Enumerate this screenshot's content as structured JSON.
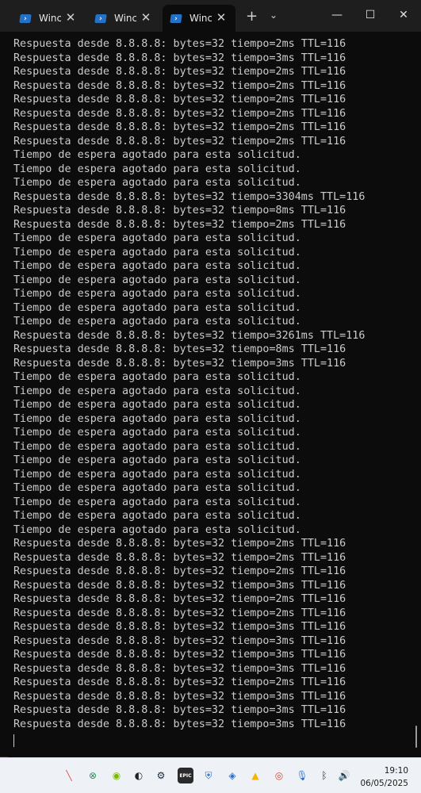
{
  "tabs": [
    {
      "title": "Winc",
      "active": false
    },
    {
      "title": "Winc",
      "active": false
    },
    {
      "title": "Winc",
      "active": true
    }
  ],
  "tabbar": {
    "new_tab": "+",
    "dropdown": "⌄"
  },
  "window_controls": {
    "minimize": "—",
    "maximize": "☐",
    "close": "✕"
  },
  "desktop_glyph": "nt",
  "terminal": {
    "lines": [
      "Respuesta desde 8.8.8.8: bytes=32 tiempo=2ms TTL=116",
      "Respuesta desde 8.8.8.8: bytes=32 tiempo=3ms TTL=116",
      "Respuesta desde 8.8.8.8: bytes=32 tiempo=2ms TTL=116",
      "Respuesta desde 8.8.8.8: bytes=32 tiempo=2ms TTL=116",
      "Respuesta desde 8.8.8.8: bytes=32 tiempo=2ms TTL=116",
      "Respuesta desde 8.8.8.8: bytes=32 tiempo=2ms TTL=116",
      "Respuesta desde 8.8.8.8: bytes=32 tiempo=2ms TTL=116",
      "Respuesta desde 8.8.8.8: bytes=32 tiempo=2ms TTL=116",
      "Tiempo de espera agotado para esta solicitud.",
      "Tiempo de espera agotado para esta solicitud.",
      "Tiempo de espera agotado para esta solicitud.",
      "Respuesta desde 8.8.8.8: bytes=32 tiempo=3304ms TTL=116",
      "Respuesta desde 8.8.8.8: bytes=32 tiempo=8ms TTL=116",
      "Respuesta desde 8.8.8.8: bytes=32 tiempo=2ms TTL=116",
      "Tiempo de espera agotado para esta solicitud.",
      "Tiempo de espera agotado para esta solicitud.",
      "Tiempo de espera agotado para esta solicitud.",
      "Tiempo de espera agotado para esta solicitud.",
      "Tiempo de espera agotado para esta solicitud.",
      "Tiempo de espera agotado para esta solicitud.",
      "Tiempo de espera agotado para esta solicitud.",
      "Respuesta desde 8.8.8.8: bytes=32 tiempo=3261ms TTL=116",
      "Respuesta desde 8.8.8.8: bytes=32 tiempo=8ms TTL=116",
      "Respuesta desde 8.8.8.8: bytes=32 tiempo=3ms TTL=116",
      "Tiempo de espera agotado para esta solicitud.",
      "Tiempo de espera agotado para esta solicitud.",
      "Tiempo de espera agotado para esta solicitud.",
      "Tiempo de espera agotado para esta solicitud.",
      "Tiempo de espera agotado para esta solicitud.",
      "Tiempo de espera agotado para esta solicitud.",
      "Tiempo de espera agotado para esta solicitud.",
      "Tiempo de espera agotado para esta solicitud.",
      "Tiempo de espera agotado para esta solicitud.",
      "Tiempo de espera agotado para esta solicitud.",
      "Tiempo de espera agotado para esta solicitud.",
      "Tiempo de espera agotado para esta solicitud.",
      "Respuesta desde 8.8.8.8: bytes=32 tiempo=2ms TTL=116",
      "Respuesta desde 8.8.8.8: bytes=32 tiempo=2ms TTL=116",
      "Respuesta desde 8.8.8.8: bytes=32 tiempo=2ms TTL=116",
      "Respuesta desde 8.8.8.8: bytes=32 tiempo=3ms TTL=116",
      "Respuesta desde 8.8.8.8: bytes=32 tiempo=2ms TTL=116",
      "Respuesta desde 8.8.8.8: bytes=32 tiempo=2ms TTL=116",
      "Respuesta desde 8.8.8.8: bytes=32 tiempo=3ms TTL=116",
      "Respuesta desde 8.8.8.8: bytes=32 tiempo=3ms TTL=116",
      "Respuesta desde 8.8.8.8: bytes=32 tiempo=3ms TTL=116",
      "Respuesta desde 8.8.8.8: bytes=32 tiempo=3ms TTL=116",
      "Respuesta desde 8.8.8.8: bytes=32 tiempo=2ms TTL=116",
      "Respuesta desde 8.8.8.8: bytes=32 tiempo=3ms TTL=116",
      "Respuesta desde 8.8.8.8: bytes=32 tiempo=3ms TTL=116",
      "Respuesta desde 8.8.8.8: bytes=32 tiempo=3ms TTL=116"
    ]
  },
  "taskbar": {
    "icons": [
      {
        "name": "pen-slash-icon",
        "glyph": "╲",
        "color": "#d9534f"
      },
      {
        "name": "xbox-icon",
        "glyph": "⊗",
        "color": "#2e8b57"
      },
      {
        "name": "nvidia-icon",
        "glyph": "◉",
        "color": "#76b900"
      },
      {
        "name": "github-icon",
        "glyph": "◐",
        "color": "#222222"
      },
      {
        "name": "steam-icon",
        "glyph": "⚙",
        "color": "#1b2838"
      },
      {
        "name": "epic-games-icon",
        "glyph": "EPIC",
        "color": "#2a2a2a"
      },
      {
        "name": "shield-icon",
        "glyph": "⛨",
        "color": "#1f6fd1"
      },
      {
        "name": "defender-icon",
        "glyph": "◈",
        "color": "#2b6cd0"
      },
      {
        "name": "drive-icon",
        "glyph": "▲",
        "color": "#f4b400"
      },
      {
        "name": "chrome-icon",
        "glyph": "◎",
        "color": "#db4437"
      },
      {
        "name": "microphone-icon",
        "glyph": "🎙",
        "color": "#2b6cd0"
      },
      {
        "name": "bluetooth-icon",
        "glyph": "ᛒ",
        "color": "#333333"
      },
      {
        "name": "volume-icon",
        "glyph": "🔊",
        "color": "#333333"
      }
    ],
    "time": "19:10",
    "date": "06/05/2025"
  }
}
